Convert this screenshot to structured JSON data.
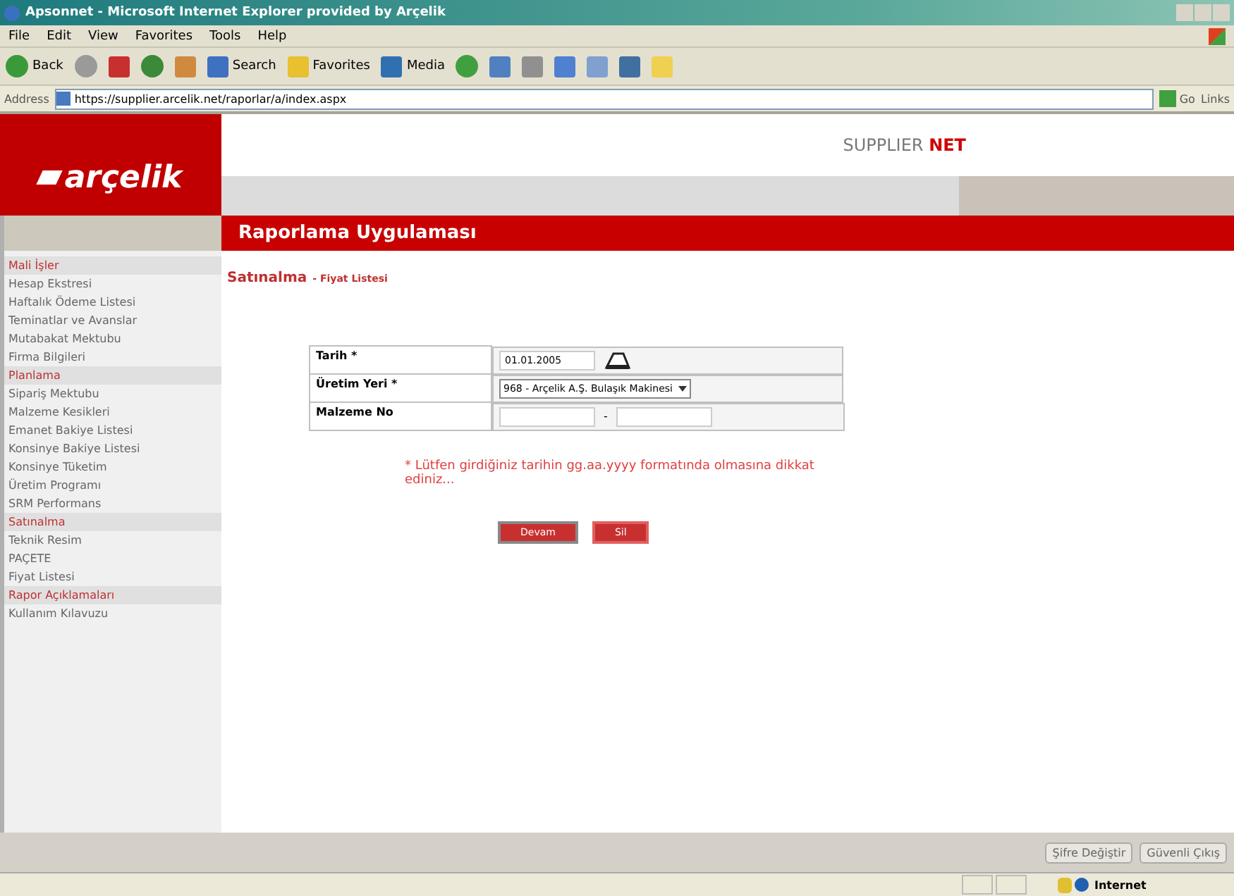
{
  "window": {
    "title": "Apsonnet - Microsoft Internet Explorer provided by Arçelik"
  },
  "menu": [
    "File",
    "Edit",
    "View",
    "Favorites",
    "Tools",
    "Help"
  ],
  "toolbar": [
    {
      "kind": "back",
      "label": "Back"
    },
    {
      "kind": "forward"
    },
    {
      "kind": "stop"
    },
    {
      "kind": "refresh"
    },
    {
      "kind": "home"
    },
    {
      "kind": "search",
      "label": "Search"
    },
    {
      "kind": "favorites",
      "label": "Favorites"
    },
    {
      "kind": "media",
      "label": "Media"
    },
    {
      "kind": "history"
    },
    {
      "kind": "mail"
    },
    {
      "kind": "print"
    },
    {
      "kind": "edit"
    },
    {
      "kind": "copy"
    },
    {
      "kind": "window"
    },
    {
      "kind": "note"
    }
  ],
  "address": {
    "label": "Address",
    "value": "https://supplier.arcelik.net/raporlar/a/index.aspx",
    "go": "Go",
    "links": "Links"
  },
  "logo": "arçelik",
  "brand": {
    "plain": "SUPPLIER ",
    "bold": "NET"
  },
  "app_title": "Raporlama Uygulaması",
  "sidebar": [
    {
      "header": "Mali İşler",
      "items": [
        "Hesap Ekstresi",
        "Haftalık Ödeme Listesi",
        "Teminatlar ve Avanslar",
        "Mutabakat Mektubu",
        "Firma Bilgileri"
      ]
    },
    {
      "header": "Planlama",
      "items": [
        "Sipariş Mektubu",
        "Malzeme Kesikleri",
        "Emanet Bakiye Listesi",
        "Konsinye Bakiye Listesi",
        "Konsinye Tüketim",
        "Üretim Programı",
        "SRM Performans"
      ]
    },
    {
      "header": "Satınalma",
      "items": [
        "Teknik Resim",
        "PAÇETE",
        "Fiyat Listesi"
      ]
    },
    {
      "header": "Rapor Açıklamaları",
      "items": [
        "Kullanım Kılavuzu"
      ]
    }
  ],
  "breadcrumb": {
    "section": "Satınalma",
    "page": "- Fiyat Listesi"
  },
  "form": [
    {
      "kind": "date",
      "label": "Tarih *",
      "value": "01.01.2005"
    },
    {
      "kind": "select",
      "label": "Üretim Yeri *",
      "value": "968 - Arçelik A.Ş. Bulaşık Makinesi"
    },
    {
      "kind": "range",
      "label": "Malzeme No",
      "separator": "-"
    }
  ],
  "note": "* Lütfen girdiğiniz tarihin gg.aa.yyyy formatında olmasına dikkat ediniz...",
  "buttons": [
    "Devam",
    "Sil"
  ],
  "footer_buttons": [
    "Şifre Değiştir",
    "Güvenli Çıkış"
  ],
  "status": {
    "zone": "Internet"
  }
}
